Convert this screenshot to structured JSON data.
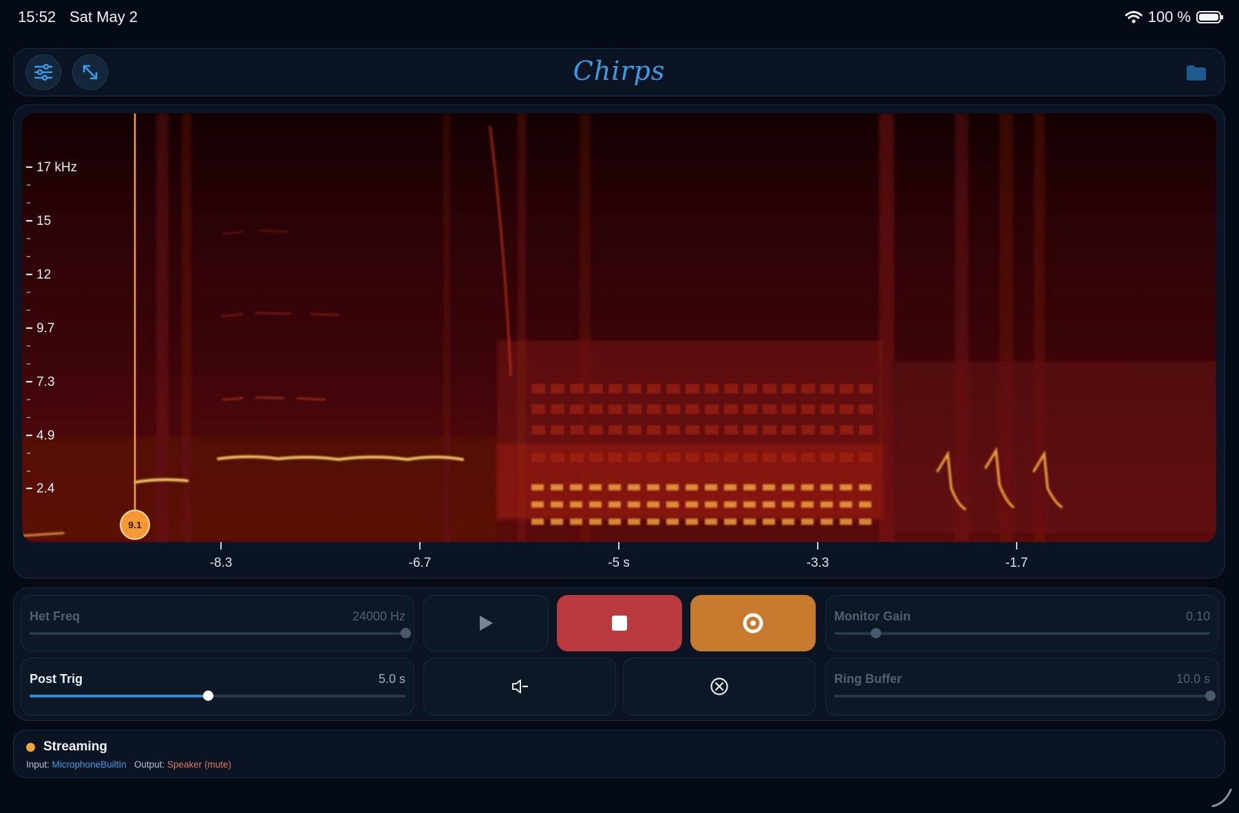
{
  "status_bar": {
    "time": "15:52",
    "date": "Sat May 2",
    "battery_text": "100 %"
  },
  "toolbar": {
    "app_title": "Chirps",
    "buttons": [
      {
        "name": "settings-sliders",
        "icon": "sliders-icon"
      },
      {
        "name": "expand",
        "icon": "expand-arrows-icon"
      },
      {
        "name": "folder",
        "icon": "folder-icon"
      }
    ]
  },
  "spectrogram": {
    "freq_labels": [
      "17 kHz",
      "15",
      "12",
      "9.7",
      "7.3",
      "4.9",
      "2.4"
    ],
    "time_labels": [
      "-8.3",
      "-6.7",
      "-5 s",
      "-3.3",
      "-1.7"
    ],
    "cursor_value": "9.1",
    "colors": {
      "low": "#150003",
      "mid": "#b5180a",
      "high": "#ffd56a",
      "cursor": "#f5a33e"
    }
  },
  "controls": {
    "het_freq": {
      "label": "Het Freq",
      "value": "24000 Hz",
      "level": 1.0,
      "enabled": false
    },
    "post_trig": {
      "label": "Post Trig",
      "value": "5.0 s",
      "level": 0.475,
      "enabled": true
    },
    "monitor_gain": {
      "label": "Monitor Gain",
      "value": "0.10",
      "level": 0.11,
      "enabled": false
    },
    "ring_buffer": {
      "label": "Ring Buffer",
      "value": "10.0 s",
      "level": 1.0,
      "enabled": false
    },
    "buttons": [
      {
        "name": "play",
        "icon": "play-icon"
      },
      {
        "name": "stop",
        "icon": "stop-icon",
        "color": "#b93a3e"
      },
      {
        "name": "record",
        "icon": "record-icon",
        "color": "#c87a2e"
      },
      {
        "name": "speaker-mute",
        "icon": "speaker-mute-icon"
      },
      {
        "name": "clear",
        "icon": "clear-circle-x-icon"
      }
    ]
  },
  "status": {
    "state": "Streaming",
    "input_label": "Input:",
    "input_value": "MicrophoneBuiltIn",
    "output_label": "Output:",
    "output_value": "Speaker (mute)",
    "indicator_color": "#f5a33e"
  }
}
